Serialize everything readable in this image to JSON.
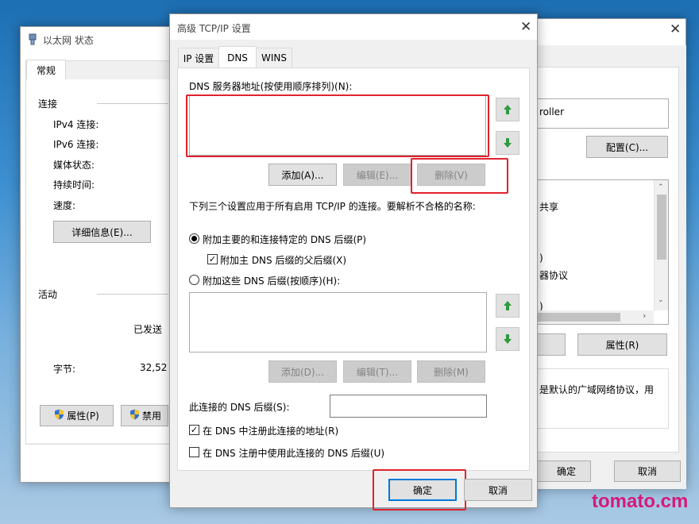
{
  "status_window": {
    "title": "以太网 状态",
    "tab": "常规",
    "section_connection": "连接",
    "ipv4_label": "IPv4 连接:",
    "ipv6_label": "IPv6 连接:",
    "media_label": "媒体状态:",
    "duration_label": "持续时间:",
    "speed_label": "速度:",
    "details_button": "详细信息(E)...",
    "section_activity": "活动",
    "sent_label": "已发送",
    "bytes_label": "字节:",
    "bytes_value": "32,52",
    "properties_button": "属性(P)",
    "disable_button": "禁用"
  },
  "properties_window": {
    "adapter_text": "roller",
    "configure_button": "配置(C)...",
    "list_item_share": "共享",
    "list_item_paren": ")",
    "list_item_protocol": "器协议",
    "list_item_paren2": ")",
    "properties_button": "属性(R)",
    "description_text": "是默认的广域网络协议，用",
    "ok_button": "确定",
    "cancel_button": "取消"
  },
  "dialog": {
    "title": "高级 TCP/IP 设置",
    "tabs": [
      {
        "label": "IP 设置"
      },
      {
        "label": "DNS"
      },
      {
        "label": "WINS"
      }
    ],
    "dns_servers_label": "DNS 服务器地址(按使用顺序排列)(N):",
    "add_button": "添加(A)...",
    "edit_button": "编辑(E)...",
    "delete_button": "删除(V)",
    "info_text": "下列三个设置应用于所有启用 TCP/IP 的连接。要解析不合格的名称:",
    "radio_primary": "附加主要的和连接特定的 DNS 后缀(P)",
    "check_parent": "附加主 DNS 后缀的父后缀(X)",
    "radio_these": "附加这些 DNS 后缀(按顺序)(H):",
    "add2_button": "添加(D)...",
    "edit2_button": "编辑(T)...",
    "delete2_button": "删除(M)",
    "dns_suffix_label": "此连接的 DNS 后缀(S):",
    "dns_suffix_value": "",
    "register_label": "在 DNS 中注册此连接的地址(R)",
    "register_suffix_label": "在 DNS 注册中使用此连接的 DNS 后缀(U)",
    "ok_button": "确定",
    "cancel_button": "取消",
    "close_glyph": "✕"
  },
  "status_close_glyph": "✕",
  "properties_close_glyph": "✕",
  "watermark": "tomato.cm",
  "colors": {
    "highlight": "#e0222e",
    "arrow": "#2e9a3f",
    "watermark": "#d6197a"
  }
}
